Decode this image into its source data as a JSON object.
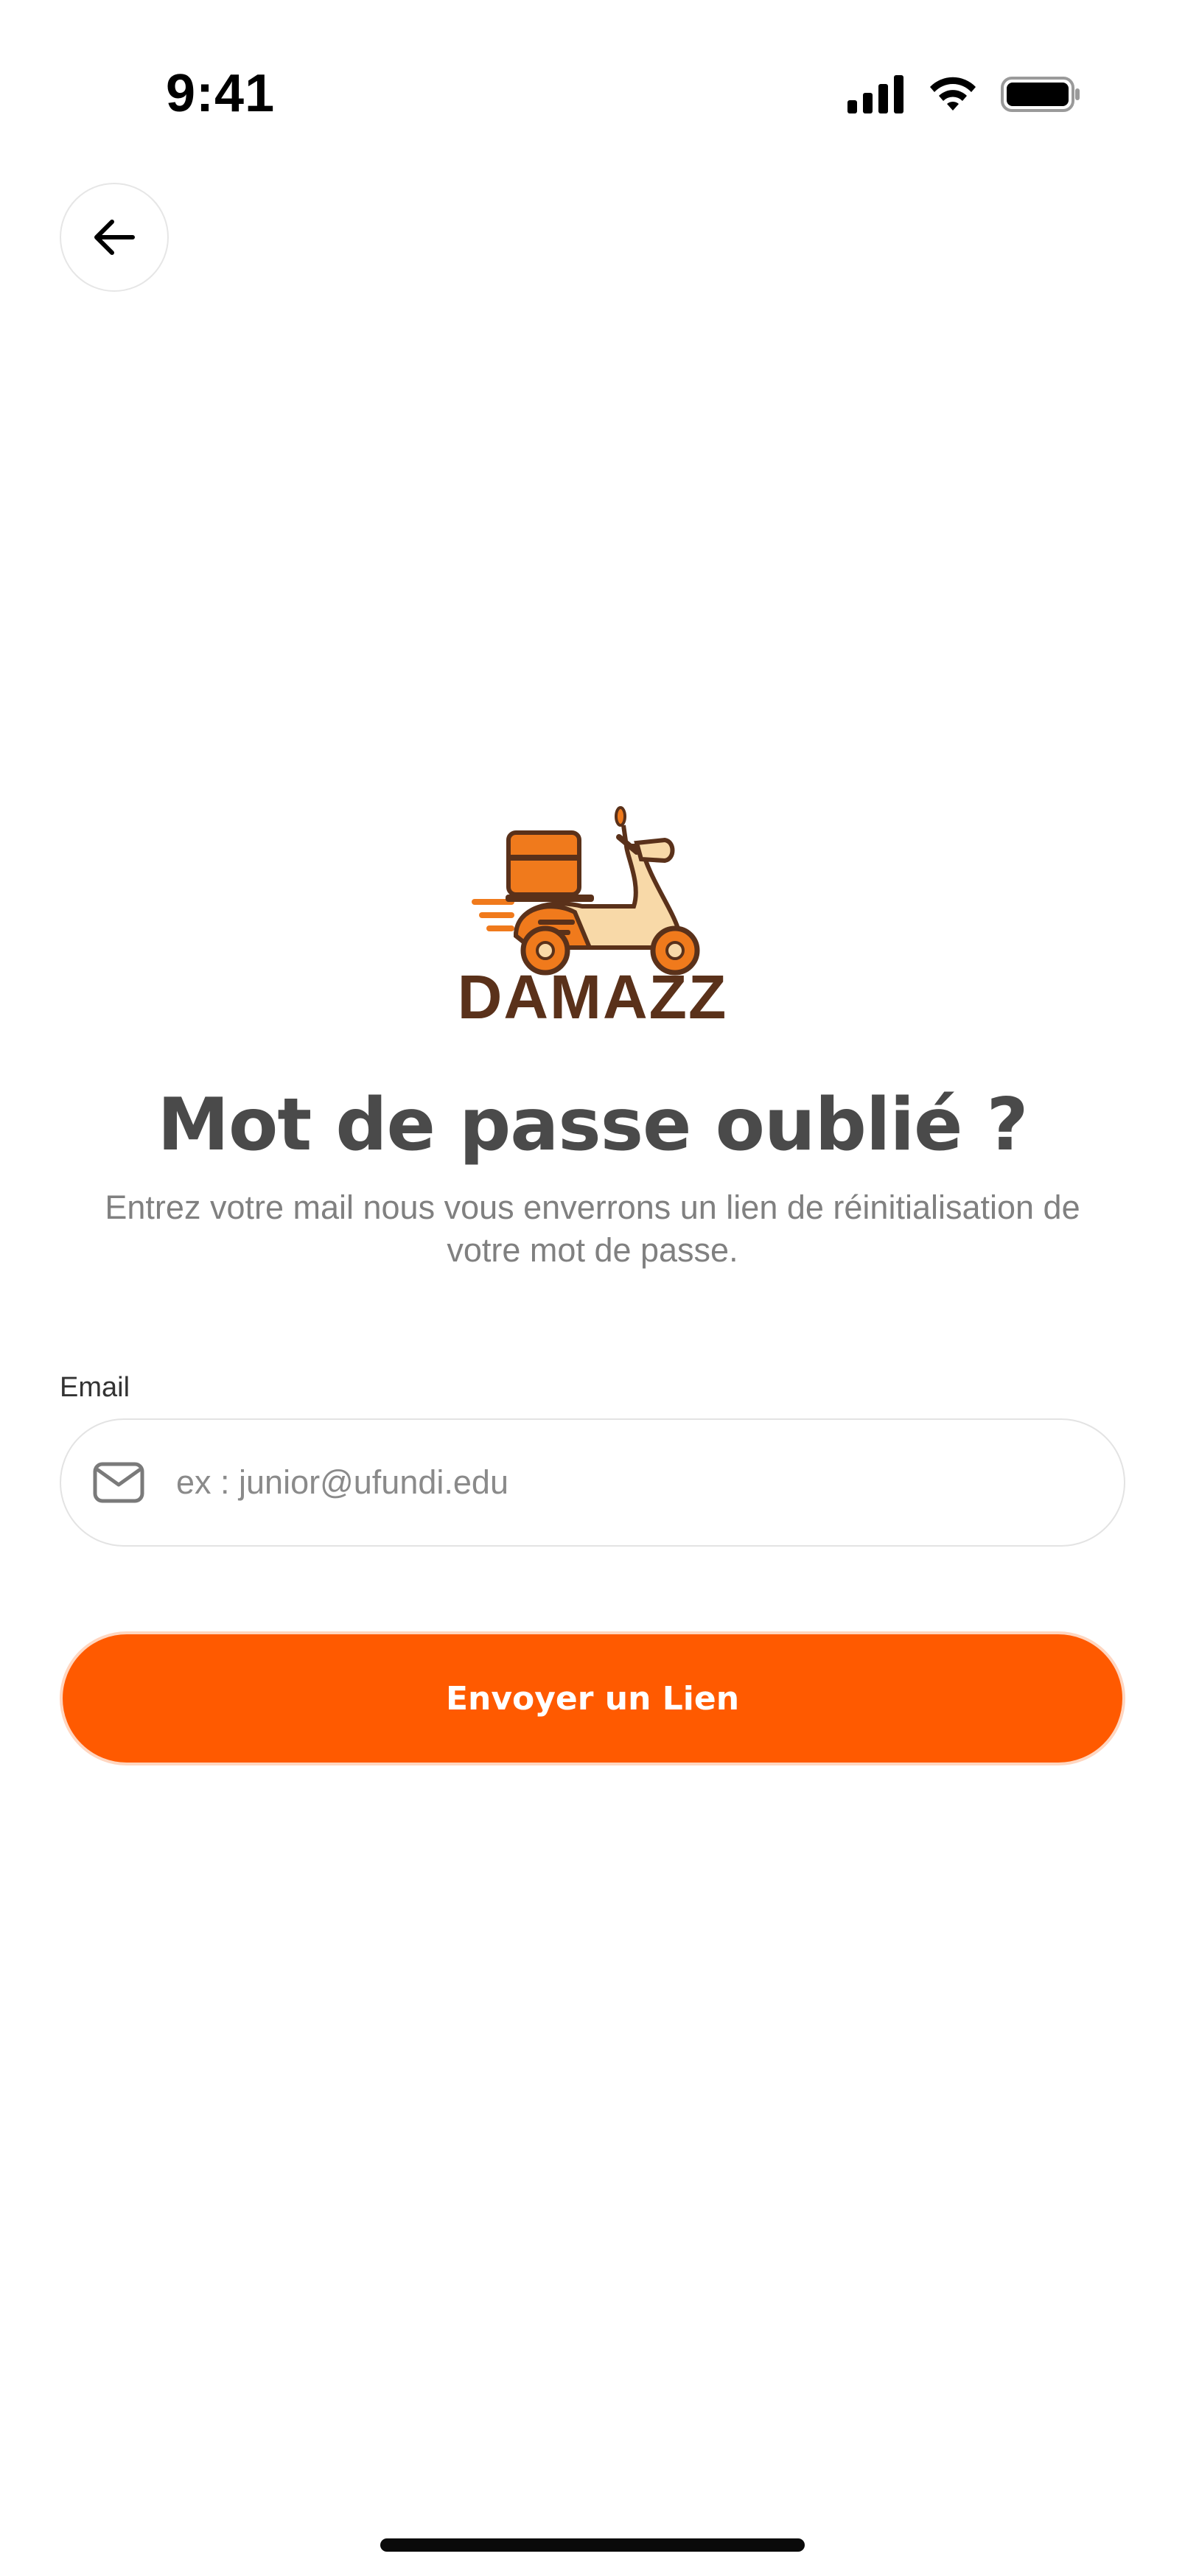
{
  "status_bar": {
    "time": "9:41",
    "icons": [
      "signal-icon",
      "wifi-icon",
      "battery-icon"
    ]
  },
  "header": {
    "back_icon": "arrow-left-icon"
  },
  "brand": {
    "name": "DAMAZZ",
    "logo_icon": "scooter-delivery-icon",
    "colors": {
      "brand_brown": "#5a311a",
      "brand_orange": "#f07a1c"
    }
  },
  "page": {
    "title": "Mot de passe oublié ?",
    "subtitle": "Entrez votre mail nous vous enverrons un lien de réinitialisation de votre mot de passe."
  },
  "form": {
    "email_label": "Email",
    "email_placeholder": "ex : junior@ufundi.edu",
    "email_value": "",
    "email_icon": "mail-icon",
    "submit_label": "Envoyer un Lien"
  },
  "colors": {
    "accent": "#ff5a00",
    "title": "#4a4a4a",
    "subtitle": "#808080",
    "border": "#e3e3e3"
  }
}
